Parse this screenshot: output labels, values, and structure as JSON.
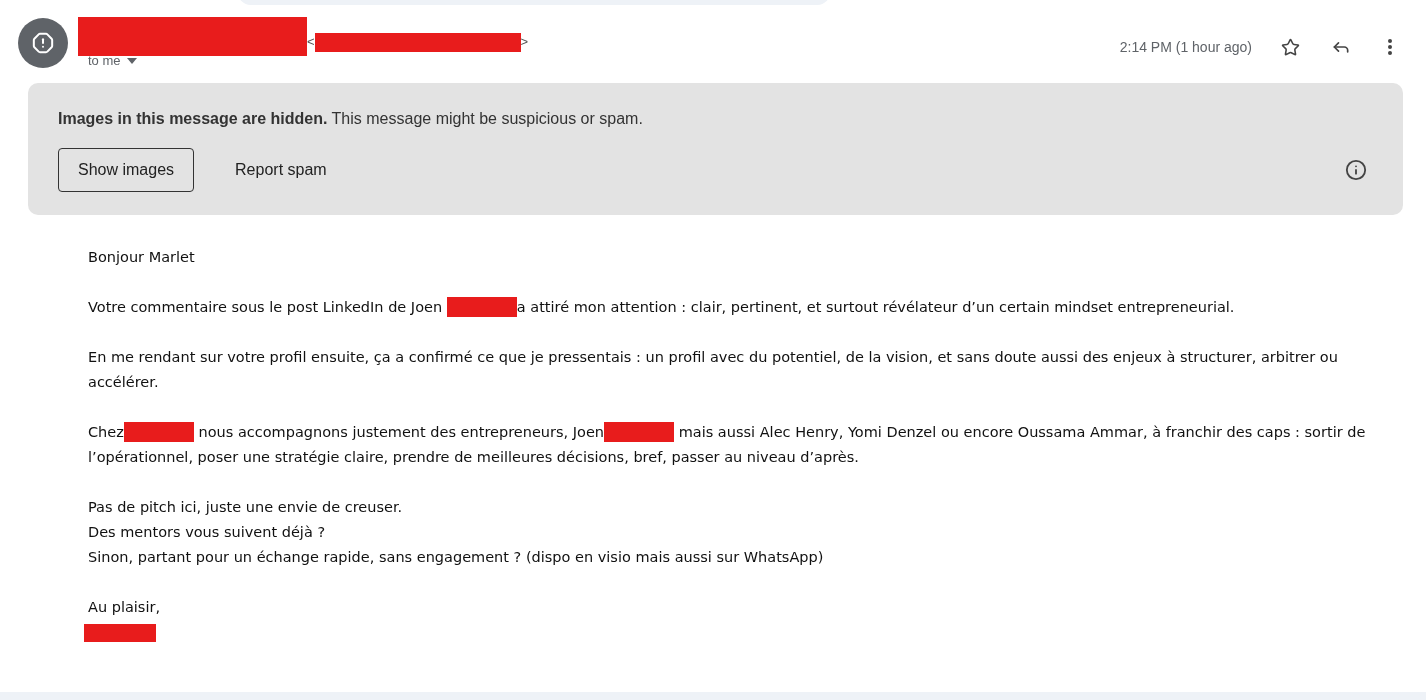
{
  "sender": {
    "email_open": "<",
    "email_close": ">"
  },
  "recipient": "to me",
  "time": "2:14 PM (1 hour ago)",
  "banner": {
    "text": "**Images in this message are hidden.** This message might be suspicious or spam.",
    "buttons": [
      {
        "label": "Show images",
        "kind": "outlined"
      },
      {
        "label": "Report spam",
        "kind": "text"
      }
    ]
  },
  "body": [
    {
      "lines": [
        [
          {
            "kind": "text",
            "text": "Bonjour Marlet"
          }
        ]
      ]
    },
    {
      "lines": [
        [
          {
            "kind": "text",
            "text": "Votre commentaire sous le post LinkedIn de Joen "
          },
          {
            "kind": "redacted"
          },
          {
            "kind": "text",
            "text": "a attiré mon attention : clair, pertinent, et surtout révélateur d’un certain mindset entrepreneurial."
          }
        ]
      ]
    },
    {
      "lines": [
        [
          {
            "kind": "text",
            "text": "En me rendant sur votre profil ensuite, ça a confirmé ce que je pressentais : un profil avec du potentiel, de la vision, et sans doute aussi des enjeux à structurer, arbitrer ou"
          }
        ],
        [
          {
            "kind": "text",
            "text": "accélérer."
          }
        ]
      ]
    },
    {
      "lines": [
        [
          {
            "kind": "text",
            "text": "Chez"
          },
          {
            "kind": "redacted"
          },
          {
            "kind": "text",
            "text": " nous accompagnons justement des entrepreneurs, Joen"
          },
          {
            "kind": "redacted"
          },
          {
            "kind": "text",
            "text": " mais aussi Alec Henry, Yomi Denzel ou encore Oussama Ammar, à franchir des caps : sortir de"
          }
        ],
        [
          {
            "kind": "text",
            "text": "l’opérationnel, poser une stratégie claire, prendre de meilleures décisions, bref, passer au niveau d’après."
          }
        ]
      ]
    },
    {
      "lines": [
        [
          {
            "kind": "text",
            "text": "Pas de pitch ici, juste une envie de creuser."
          }
        ],
        [
          {
            "kind": "text",
            "text": "Des mentors vous suivent déjà ?"
          }
        ],
        [
          {
            "kind": "text",
            "text": "Sinon, partant pour un échange rapide, sans engagement ? (dispo en visio mais aussi sur WhatsApp)"
          }
        ]
      ]
    },
    {
      "lines": [
        [
          {
            "kind": "text",
            "text": "Au plaisir,"
          }
        ],
        [
          {
            "kind": "redacted"
          }
        ]
      ]
    }
  ]
}
